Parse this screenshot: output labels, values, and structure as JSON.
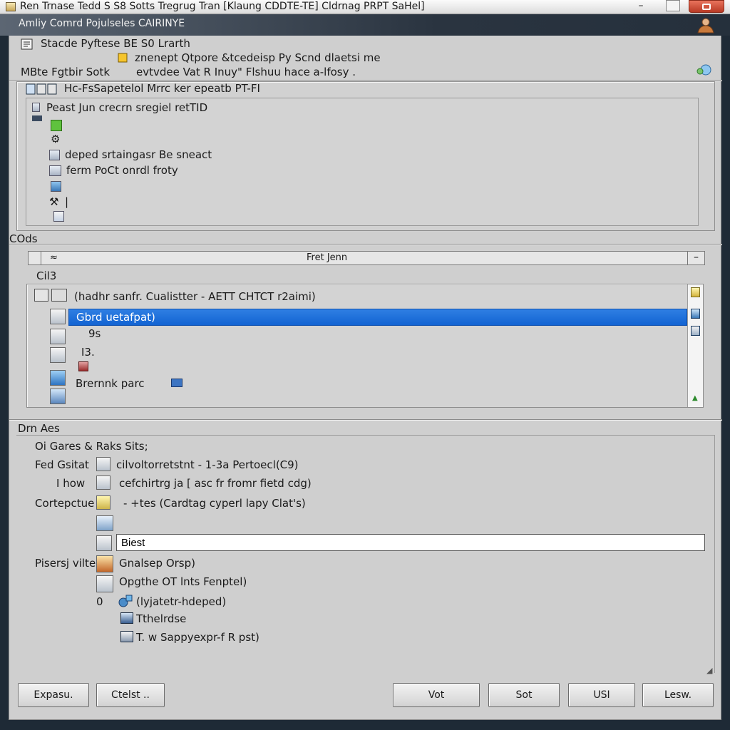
{
  "window": {
    "title": "Ren Trnase Tedd S S8 Sotts  Tregrug Tran [Klaung CDDTE-TE] Cldrnag PRPT SaHel]",
    "ribbon_text": "Amliy Comrd Pojulseles  CAIRINYE"
  },
  "header": {
    "line1": "Stacde Pyftese  BE  S0  Lrarth",
    "line2": "znenept Qtpore &tcedeisp Py  Scnd dlaetsi me",
    "line3_label": "MBte Fgtbir Sotk",
    "line3_value": "evtvdee Vat R Inuy\" Flshuu hace a-lfosy ."
  },
  "top_panel": {
    "title": "Hc-FsSapetelol  Mrrc ker  epeatb  PT-FI",
    "items": [
      {
        "icon": "document-icon",
        "label": "Peast Jun crecrn sregiel retTID"
      },
      {
        "icon": "green-square-icon",
        "label": ""
      },
      {
        "icon": "gear-icon",
        "label": ""
      },
      {
        "icon": "list-icon",
        "label": "deped srtaingasr Be sneact"
      },
      {
        "icon": "table-icon",
        "label": "ferm PoCt onrdl froty"
      },
      {
        "icon": "image-icon",
        "label": ""
      },
      {
        "icon": "tool-icon",
        "label": "|"
      },
      {
        "icon": "file-icon",
        "label": ""
      }
    ]
  },
  "code_section": {
    "label": "COds",
    "combo_value": "Fret Jenn",
    "sub_label": "Cil3",
    "list": [
      {
        "icon": "folder-icon",
        "label": "(hadhr sanfr. Cualistter - AETT CHTCT r2aimi)"
      },
      {
        "icon": "folder-icon",
        "label": "Gbrd uetafpat)",
        "selected": true
      },
      {
        "icon": "gear-icon",
        "label": "9s"
      },
      {
        "icon": "chart-icon",
        "label": "I3."
      },
      {
        "icon": "pencil-icon",
        "label": ""
      },
      {
        "icon": "picture-icon",
        "label": "Brernnk parc"
      },
      {
        "icon": "photo-icon",
        "label": ""
      }
    ]
  },
  "details_section": {
    "label": "Drn Aes",
    "sub_label": "Oi Gares & Raks Sits;",
    "rows": [
      {
        "label": "Fed Gsitat",
        "icon": "folder-icon",
        "value": "cilvoltorretstnt - 1-3a Pertoecl(C9)"
      },
      {
        "label": "I how",
        "icon": "tool-icon",
        "value": "cefchirtrg ja [ asc fr fromr fietd cdg)"
      },
      {
        "label": "Cortepctue",
        "icon": "folder-icon",
        "value": "- +tes (Cardtag cyperl lapy Clat's)"
      },
      {
        "label": "",
        "icon": "table-icon",
        "value": ""
      }
    ],
    "input_value": "Biest",
    "options_label": "Pisersj vilte",
    "options": [
      {
        "icon": "palette-icon",
        "label": "Gnalsep Orsp)"
      },
      {
        "icon": "printer-icon",
        "label": "Opgthe OT lnts Fenptel)"
      },
      {
        "icon": "pointer-icon",
        "label": "(lyjatetr-hdeped)"
      },
      {
        "icon": "monitor-icon",
        "label": "Tthelrdse"
      },
      {
        "icon": "window-icon",
        "label": "T.  w  Sappyexpr-f R  pst)"
      }
    ],
    "radio_glyph": "0"
  },
  "footer": {
    "buttons": [
      "Expasu.",
      "Ctelst ..",
      "Vot",
      "Sot",
      "USI",
      "Lesw."
    ]
  }
}
